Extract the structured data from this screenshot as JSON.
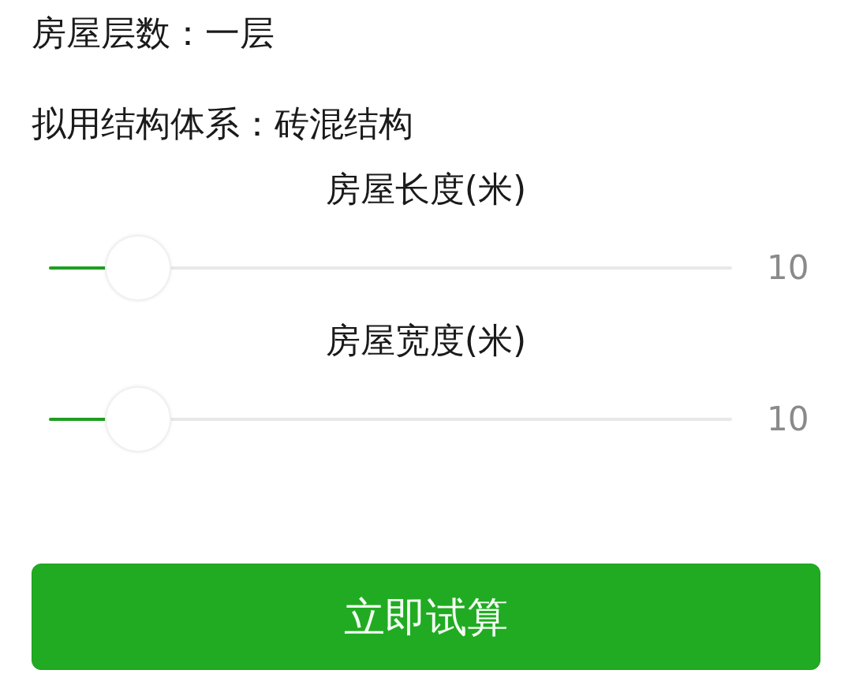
{
  "info_lines": [
    "房屋层数：一层",
    "拟用结构体系：砖混结构"
  ],
  "sliders": [
    {
      "label": "房屋长度(米)",
      "level": 0.13,
      "reading": "10"
    },
    {
      "label": "房屋宽度(米)",
      "level": 0.13,
      "reading": "10"
    }
  ],
  "button": {
    "label": "立即试算"
  }
}
